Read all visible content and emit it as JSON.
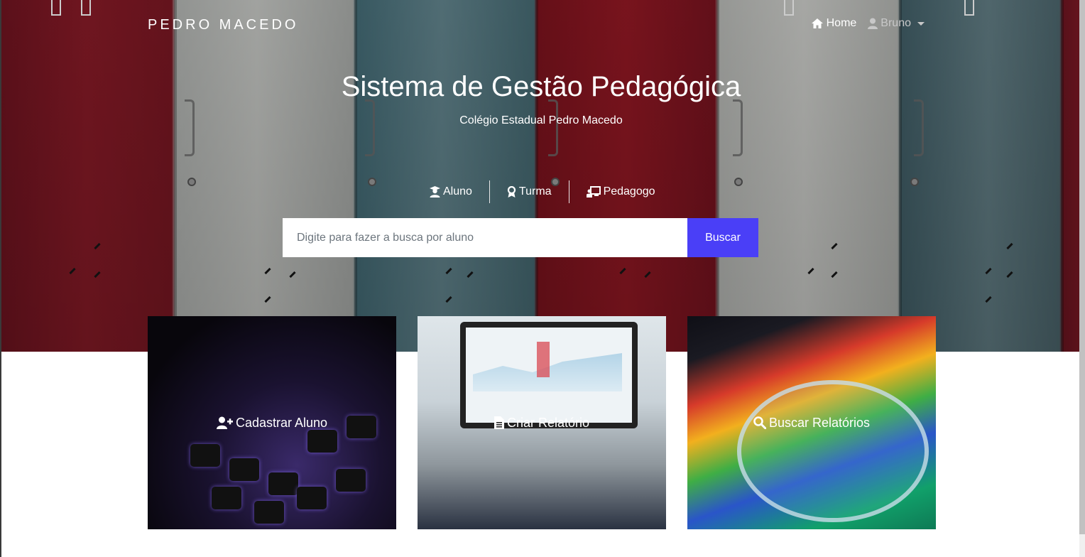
{
  "header": {
    "brand": "PEDRO MACEDO",
    "nav": {
      "home_label": "Home",
      "user_label": "Bruno"
    }
  },
  "hero": {
    "title": "Sistema de Gestão Pedagógica",
    "subtitle": "Colégio Estadual Pedro Macedo"
  },
  "filters": [
    {
      "label": "Aluno",
      "icon": "user-graduate-icon"
    },
    {
      "label": "Turma",
      "icon": "award-icon"
    },
    {
      "label": "Pedagogo",
      "icon": "chalkboard-teacher-icon"
    }
  ],
  "search": {
    "placeholder": "Digite para fazer a busca por aluno",
    "button_label": "Buscar",
    "button_color": "#4a3ff7"
  },
  "cards": [
    {
      "label": "Cadastrar Aluno",
      "icon": "user-plus-icon"
    },
    {
      "label": "Criar Relatório",
      "icon": "file-icon"
    },
    {
      "label": "Buscar Relatórios",
      "icon": "search-icon"
    }
  ]
}
